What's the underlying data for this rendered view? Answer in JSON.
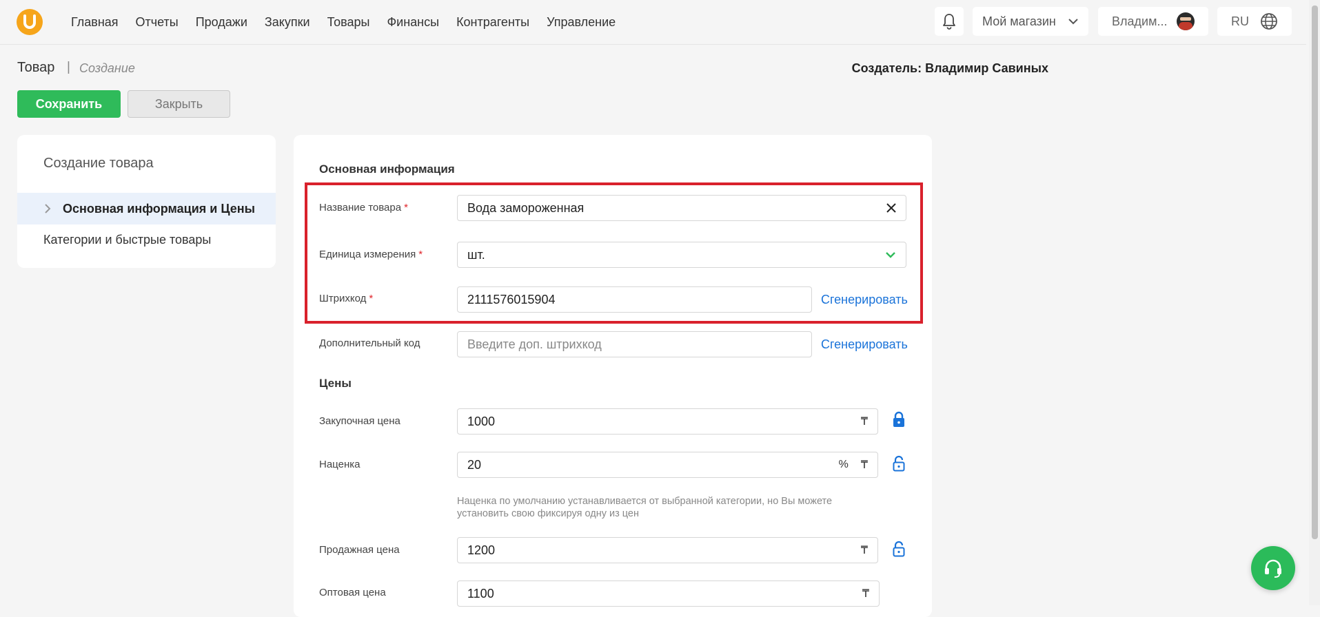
{
  "nav": {
    "logo_letter": "U",
    "items": [
      "Главная",
      "Отчеты",
      "Продажи",
      "Закупки",
      "Товары",
      "Финансы",
      "Контрагенты",
      "Управление"
    ],
    "store": "Мой магазин",
    "user": "Владим...",
    "lang": "RU"
  },
  "header": {
    "title": "Товар",
    "separator": "|",
    "subtitle": "Создание",
    "creator": "Создатель: Владимир Савиных",
    "save_label": "Сохранить",
    "close_label": "Закрыть"
  },
  "sidebar": {
    "title": "Создание товара",
    "items": [
      {
        "label": "Основная информация и Цены",
        "active": true
      },
      {
        "label": "Категории и быстрые товары",
        "active": false
      }
    ]
  },
  "form": {
    "section_main": "Основная информация",
    "name_label": "Название товара",
    "name_value": "Вода замороженная",
    "unit_label": "Единица измерения",
    "unit_value": "шт.",
    "barcode_label": "Штрихкод",
    "barcode_value": "2111576015904",
    "generate_label": "Сгенерировать",
    "extra_code_label": "Дополнительный код",
    "extra_code_placeholder": "Введите доп. штрихкод",
    "required_mark": "*",
    "section_prices": "Цены",
    "purchase_label": "Закупочная цена",
    "purchase_value": "1000",
    "markup_label": "Наценка",
    "markup_value": "20",
    "markup_hint": "Наценка по умолчанию устанавливается от выбранной категории, но Вы можете установить свою фиксируя одну из цен",
    "sale_label": "Продажная цена",
    "sale_value": "1200",
    "wholesale_label": "Оптовая цена",
    "wholesale_value": "1100",
    "currency_symbol": "₸",
    "percent_symbol": "%"
  },
  "colors": {
    "accent_green": "#2fbb5a",
    "link_blue": "#1a73d9",
    "highlight_red": "#d9212c",
    "logo_orange": "#f6a51a"
  }
}
